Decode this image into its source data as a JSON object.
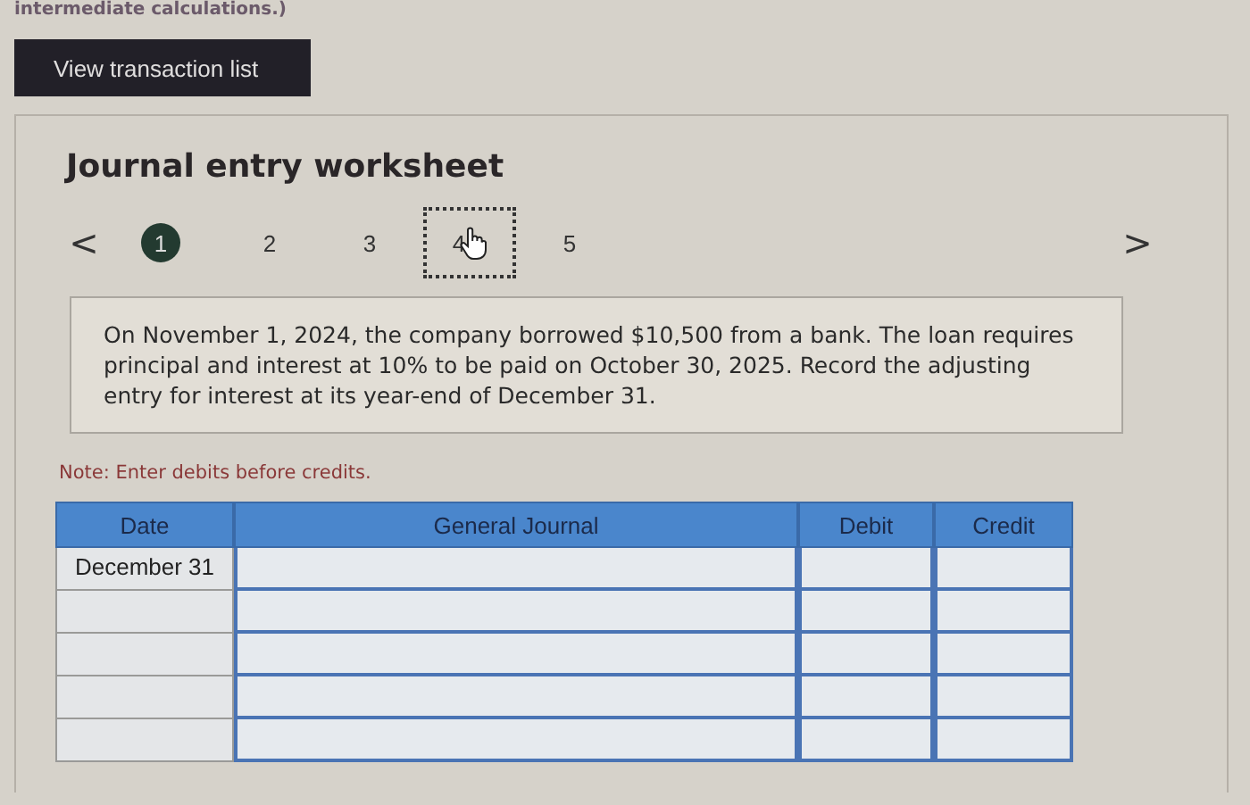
{
  "top_text": "intermediate calculations.)",
  "view_button": "View transaction list",
  "worksheet": {
    "title": "Journal entry worksheet",
    "prev": "<",
    "next": ">",
    "steps": [
      {
        "label": "1",
        "selected": true,
        "focused": false
      },
      {
        "label": "2",
        "selected": false,
        "focused": false
      },
      {
        "label": "3",
        "selected": false,
        "focused": false
      },
      {
        "label": "4",
        "selected": false,
        "focused": true
      },
      {
        "label": "5",
        "selected": false,
        "focused": false
      }
    ],
    "question": "On November 1, 2024, the company borrowed $10,500 from a bank. The loan requires principal and interest at 10% to be paid on October 30, 2025. Record the adjusting entry for interest at its year-end of December 31.",
    "note": "Note: Enter debits before credits.",
    "table": {
      "columns": [
        "Date",
        "General Journal",
        "Debit",
        "Credit"
      ],
      "rows": [
        {
          "date": "December 31"
        },
        {},
        {},
        {},
        {}
      ]
    }
  }
}
